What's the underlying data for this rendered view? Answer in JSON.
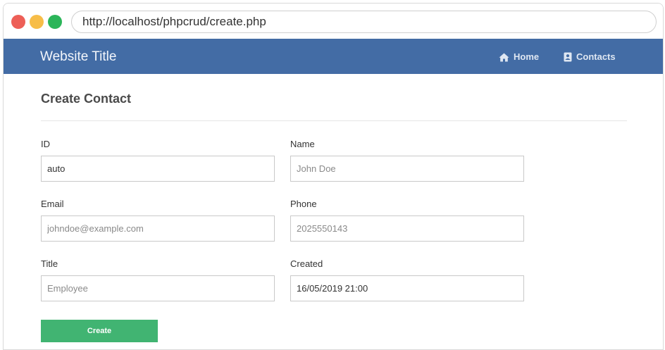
{
  "browser": {
    "url": "http://localhost/phpcrud/create.php"
  },
  "navbar": {
    "title": "Website Title",
    "links": [
      {
        "label": "Home",
        "icon": "home-icon"
      },
      {
        "label": "Contacts",
        "icon": "contact-card-icon"
      }
    ],
    "background": "#436ca5"
  },
  "page": {
    "heading": "Create Contact"
  },
  "form": {
    "id": {
      "label": "ID",
      "value": "auto",
      "placeholder": ""
    },
    "name": {
      "label": "Name",
      "value": "",
      "placeholder": "John Doe"
    },
    "email": {
      "label": "Email",
      "value": "",
      "placeholder": "johndoe@example.com"
    },
    "phone": {
      "label": "Phone",
      "value": "",
      "placeholder": "2025550143"
    },
    "title": {
      "label": "Title",
      "value": "",
      "placeholder": "Employee"
    },
    "created": {
      "label": "Created",
      "value": "16/05/2019 21:00",
      "placeholder": ""
    },
    "submit_label": "Create",
    "submit_color": "#41b472"
  }
}
